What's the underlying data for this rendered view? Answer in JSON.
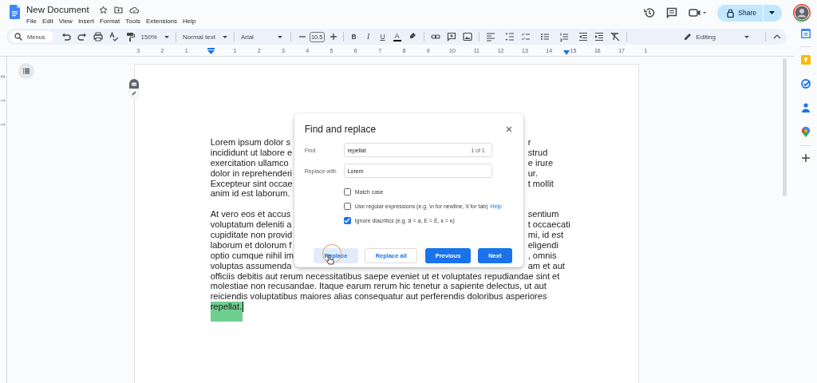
{
  "document": {
    "title": "New Document"
  },
  "menu": [
    "File",
    "Edit",
    "View",
    "Insert",
    "Format",
    "Tools",
    "Extensions",
    "Help"
  ],
  "share_button": {
    "label": "Share"
  },
  "toolbar": {
    "search_placeholder": "Menus",
    "zoom": "150%",
    "style": "Normal text",
    "font": "Arial",
    "font_size": "10.5",
    "format_buttons": [
      "B",
      "I",
      "U",
      "A"
    ],
    "mode": "Editing"
  },
  "ruler": {
    "left_labels": [
      "3",
      "2",
      "1"
    ],
    "right_labels": [
      "1",
      "2",
      "3",
      "4",
      "5",
      "6",
      "7",
      "8",
      "9",
      "10",
      "11",
      "12",
      "13",
      "14",
      "15",
      "16",
      "17",
      "1"
    ]
  },
  "vertical_ruler": {
    "labels": [
      "2",
      "1",
      "1"
    ]
  },
  "body_lines": [
    {
      "kind": "split",
      "left": "Lorem ipsum dolor s",
      "right": "r"
    },
    {
      "kind": "split",
      "left": "incididunt ut labore e",
      "right": "strud"
    },
    {
      "kind": "split",
      "left": "exercitation ullamco",
      "right": "e irure"
    },
    {
      "kind": "split",
      "left": "dolor in reprehenderi",
      "right": "ur."
    },
    {
      "kind": "split",
      "left": "Excepteur sint occae",
      "right": "t mollit"
    },
    {
      "kind": "full",
      "text": "anim id est laborum."
    },
    {
      "kind": "blank"
    },
    {
      "kind": "split",
      "left": "At vero eos et accus",
      "right": "sentium"
    },
    {
      "kind": "split",
      "left": "voluptatum deleniti a",
      "right": "t occaecati"
    },
    {
      "kind": "split",
      "left": "cupiditate non provid",
      "right": "mi, id est"
    },
    {
      "kind": "split",
      "left": "laborum et dolorum f",
      "right": "eligendi"
    },
    {
      "kind": "split",
      "left": "optio cumque nihil im",
      "right": ", omnis"
    },
    {
      "kind": "split",
      "left": "voluptas assumenda",
      "right": "am et aut"
    },
    {
      "kind": "full",
      "text": "officiis debitis aut rerum necessitatibus saepe eveniet ut et voluptates repudiandae sint et"
    },
    {
      "kind": "full",
      "text": "molestiae non recusandae. Itaque earum rerum hic tenetur a sapiente delectus, ut aut"
    },
    {
      "kind": "full",
      "text": "reiciendis voluptatibus maiores alias consequatur aut perferendis doloribus asperiores"
    },
    {
      "kind": "match",
      "text": "repellat."
    }
  ],
  "find_replace_dialog": {
    "title": "Find and replace",
    "find": {
      "label": "Find",
      "value": "repellat",
      "count": "1 of 1"
    },
    "replace": {
      "label": "Replace with",
      "value": "Lorem"
    },
    "options": [
      {
        "label": "Match case",
        "checked": false
      },
      {
        "label": "Use regular expressions (e.g. \\n for newline, \\t for tab)",
        "link": "Help",
        "checked": false
      },
      {
        "label": "Ignore diacritics (e.g. ä = a, E = É, ĸ = κ)",
        "checked": true
      }
    ],
    "buttons": [
      {
        "label": "Replace",
        "kind": "tonal"
      },
      {
        "label": "Replace all",
        "kind": "outlined"
      },
      {
        "label": "Previous",
        "kind": "filled"
      },
      {
        "label": "Next",
        "kind": "filled"
      }
    ]
  }
}
